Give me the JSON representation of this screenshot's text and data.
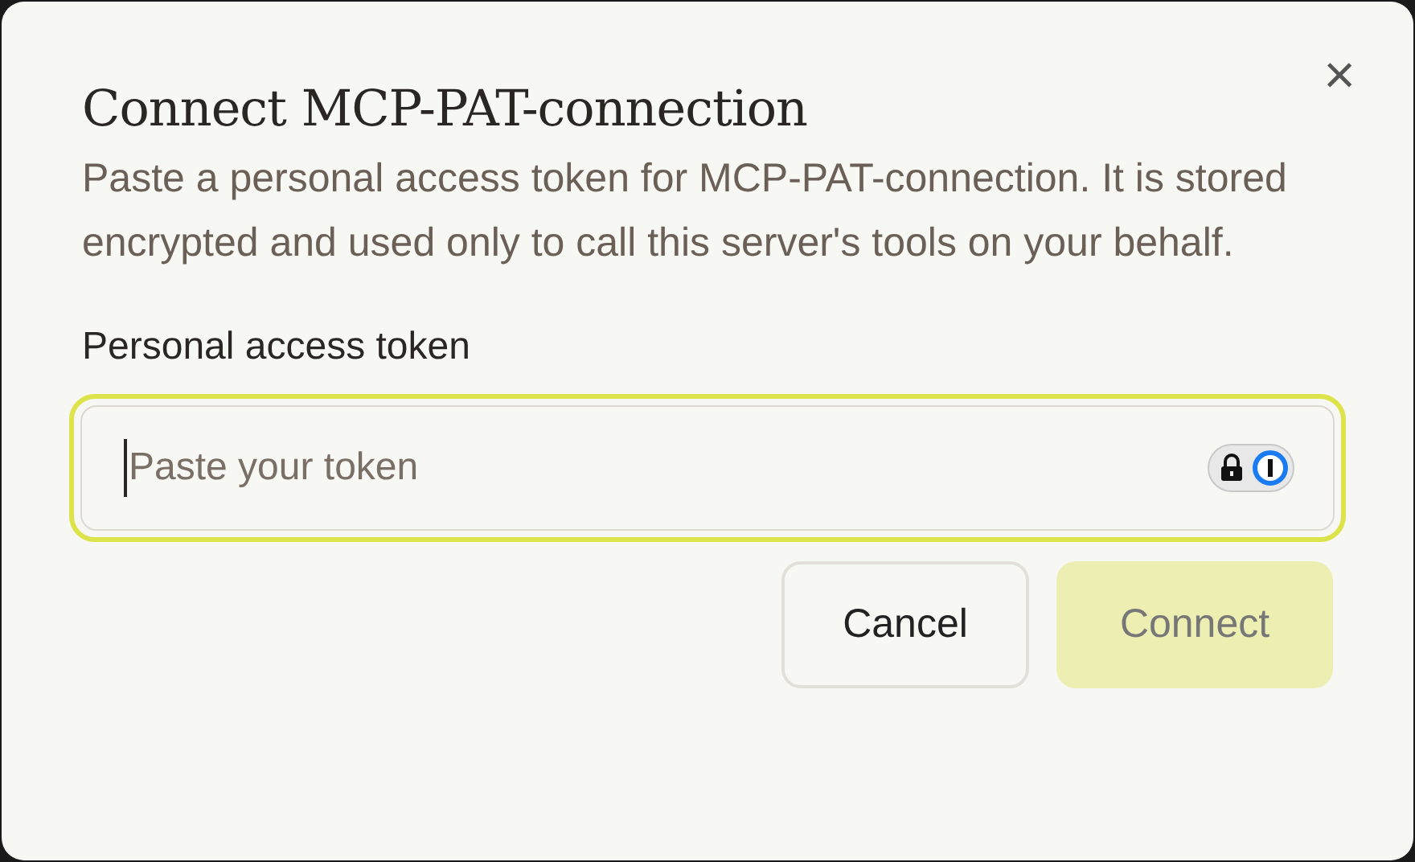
{
  "dialog": {
    "title": "Connect MCP-PAT-connection",
    "description": "Paste a personal access token for MCP-PAT-connection. It is stored encrypted and used only to call this server's tools on your behalf.",
    "close_label": "×",
    "field": {
      "label": "Personal access token",
      "placeholder": "Paste your token",
      "focused": true
    },
    "buttons": [
      {
        "label": "Cancel",
        "kind": "secondary",
        "disabled": false
      },
      {
        "label": "Connect",
        "kind": "primary",
        "disabled": true
      }
    ]
  }
}
